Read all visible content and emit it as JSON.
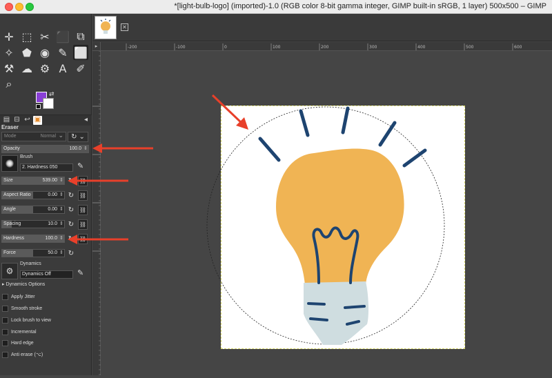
{
  "window": {
    "title": "*[light-bulb-logo] (imported)-1.0 (RGB color 8-bit gamma integer, GIMP built-in sRGB, 1 layer) 500x500 – GIMP"
  },
  "toolbox": {
    "tools": [
      {
        "name": "move-tool-icon",
        "glyph": "✛"
      },
      {
        "name": "rect-select-tool-icon",
        "glyph": "⬚"
      },
      {
        "name": "scissors-tool-icon",
        "glyph": "✂"
      },
      {
        "name": "foreground-select-tool-icon",
        "glyph": "⬛"
      },
      {
        "name": "crop-tool-icon",
        "glyph": "⧉"
      },
      {
        "name": "unified-transform-tool-icon",
        "glyph": "✧"
      },
      {
        "name": "warp-transform-tool-icon",
        "glyph": "⬟"
      },
      {
        "name": "bucket-fill-tool-icon",
        "glyph": "◉"
      },
      {
        "name": "paintbrush-tool-icon",
        "glyph": "✎"
      },
      {
        "name": "eraser-tool-icon",
        "glyph": "⬜"
      },
      {
        "name": "clone-tool-icon",
        "glyph": "⚒"
      },
      {
        "name": "smudge-tool-icon",
        "glyph": "☁"
      },
      {
        "name": "dodge-burn-tool-icon",
        "glyph": "⚙"
      },
      {
        "name": "text-tool-icon",
        "glyph": "A"
      },
      {
        "name": "color-picker-tool-icon",
        "glyph": "✐"
      },
      {
        "name": "zoom-tool-icon",
        "glyph": "⌕"
      }
    ],
    "fg_color": "#8a3fd6",
    "bg_color": "#ffffff"
  },
  "tool_options": {
    "title": "Eraser",
    "mode_label": "Mode",
    "mode_value": "Normal",
    "opacity": {
      "label": "Opacity",
      "value": "100.0"
    },
    "brush": {
      "caption": "Brush",
      "name": "2. Hardness 050"
    },
    "size": {
      "label": "Size",
      "value": "539.00"
    },
    "aspect_ratio": {
      "label": "Aspect Ratio",
      "value": "0.00"
    },
    "angle": {
      "label": "Angle",
      "value": "0.00"
    },
    "spacing": {
      "label": "Spacing",
      "value": "10.0"
    },
    "hardness": {
      "label": "Hardness",
      "value": "100.0"
    },
    "force": {
      "label": "Force",
      "value": "50.0"
    },
    "dynamics": {
      "caption": "Dynamics",
      "name": "Dynamics Off"
    },
    "dynamics_options_label": "Dynamics Options",
    "checkboxes": [
      "Apply Jitter",
      "Smooth stroke",
      "Lock brush to view",
      "Incremental",
      "Hard edge",
      "Anti erase  (⌥)"
    ]
  },
  "rulers": {
    "top_labels": [
      "-200",
      "-100",
      "0",
      "100",
      "200",
      "300",
      "400",
      "500",
      "600"
    ],
    "left_labels": [
      "0",
      "100",
      "200",
      "300"
    ]
  },
  "colors": {
    "arrow_red": "#e8402a",
    "bulb_orange": "#f0b454",
    "bulb_navy": "#1e4470",
    "bulb_base": "#cfdde0"
  }
}
